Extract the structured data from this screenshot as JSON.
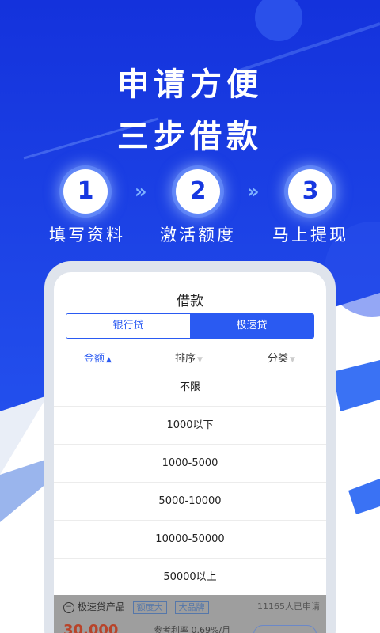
{
  "headline": {
    "line1": "申请方便",
    "line2": "三步借款"
  },
  "steps": [
    {
      "num": "1",
      "label": "填写资料"
    },
    {
      "num": "2",
      "label": "激活额度"
    },
    {
      "num": "3",
      "label": "马上提现"
    }
  ],
  "arrow": "»",
  "colors": {
    "brand_blue": "#1f47f0",
    "accent": "#2a5af2",
    "amount_red": "#b8442a"
  },
  "loan": {
    "title": "借款",
    "tabs": [
      {
        "label": "银行贷",
        "selected": false
      },
      {
        "label": "极速贷",
        "selected": true
      }
    ],
    "filters": [
      {
        "label": "金额",
        "active": true,
        "icon": "caret-up-icon"
      },
      {
        "label": "排序",
        "active": false,
        "icon": "caret-down-icon"
      },
      {
        "label": "分类",
        "active": false,
        "icon": "caret-down-icon"
      }
    ],
    "amount_options": [
      "不限",
      "1000以下",
      "1000-5000",
      "5000-10000",
      "10000-50000",
      "50000以上"
    ]
  },
  "product": {
    "name": "极速贷产品",
    "tags": [
      "额度大",
      "大品牌"
    ],
    "applicants": "11165人已申请",
    "amount": "30,000",
    "rate": "参考利率 0.69%/月"
  }
}
